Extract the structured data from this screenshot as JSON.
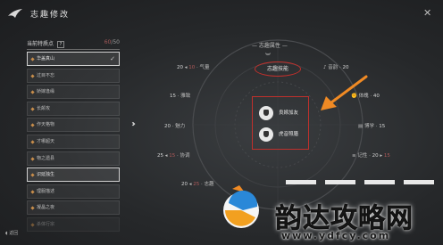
{
  "header": {
    "title": "志趣修改",
    "close_icon": "close-icon"
  },
  "left_panel": {
    "header_label": "当前特质点",
    "help_label": "?",
    "points_current": "60",
    "points_max": "/50",
    "items": [
      {
        "label": "华盖真山",
        "selected": true
      },
      {
        "label": "过目不忘"
      },
      {
        "label": "娇嫁逢缘"
      },
      {
        "label": "长颠攻"
      },
      {
        "label": "作天格物"
      },
      {
        "label": "才哪超天"
      },
      {
        "label": "物之遗县"
      },
      {
        "label": "识延独生"
      },
      {
        "label": "理服描述"
      },
      {
        "label": "凝晶之夜"
      },
      {
        "label": "杀体行宗"
      }
    ],
    "mouse_hint": "返回"
  },
  "radar": {
    "title": "志趣属性",
    "center_button": "志趣技能",
    "stats": {
      "qiliang": {
        "label": "气量",
        "value": "20",
        "delta": "10"
      },
      "yindong": {
        "label": "音韵",
        "value": "20"
      },
      "youxi": {
        "label": "雅致",
        "value": "15"
      },
      "tipo": {
        "label": "体魄",
        "value": "40"
      },
      "meili": {
        "label": "魅力",
        "value": "20"
      },
      "boxue": {
        "label": "博学",
        "value": "15"
      },
      "xietiao": {
        "label": "协调",
        "value": "25",
        "delta": "15"
      },
      "jixing": {
        "label": "记性",
        "value": "20",
        "delta": "15"
      },
      "zhidu": {
        "label": "志趣",
        "value": "20",
        "delta": "25"
      }
    },
    "traits": [
      {
        "label": "良嫁加友",
        "icon": "person-icon"
      },
      {
        "label": "虎音照膳",
        "icon": "tiger-icon"
      }
    ]
  },
  "watermark": {
    "text": "韵达攻略网",
    "url": "www.ydfcy.com"
  },
  "colors": {
    "highlight": "#c0302c",
    "arrow": "#f08a24"
  }
}
